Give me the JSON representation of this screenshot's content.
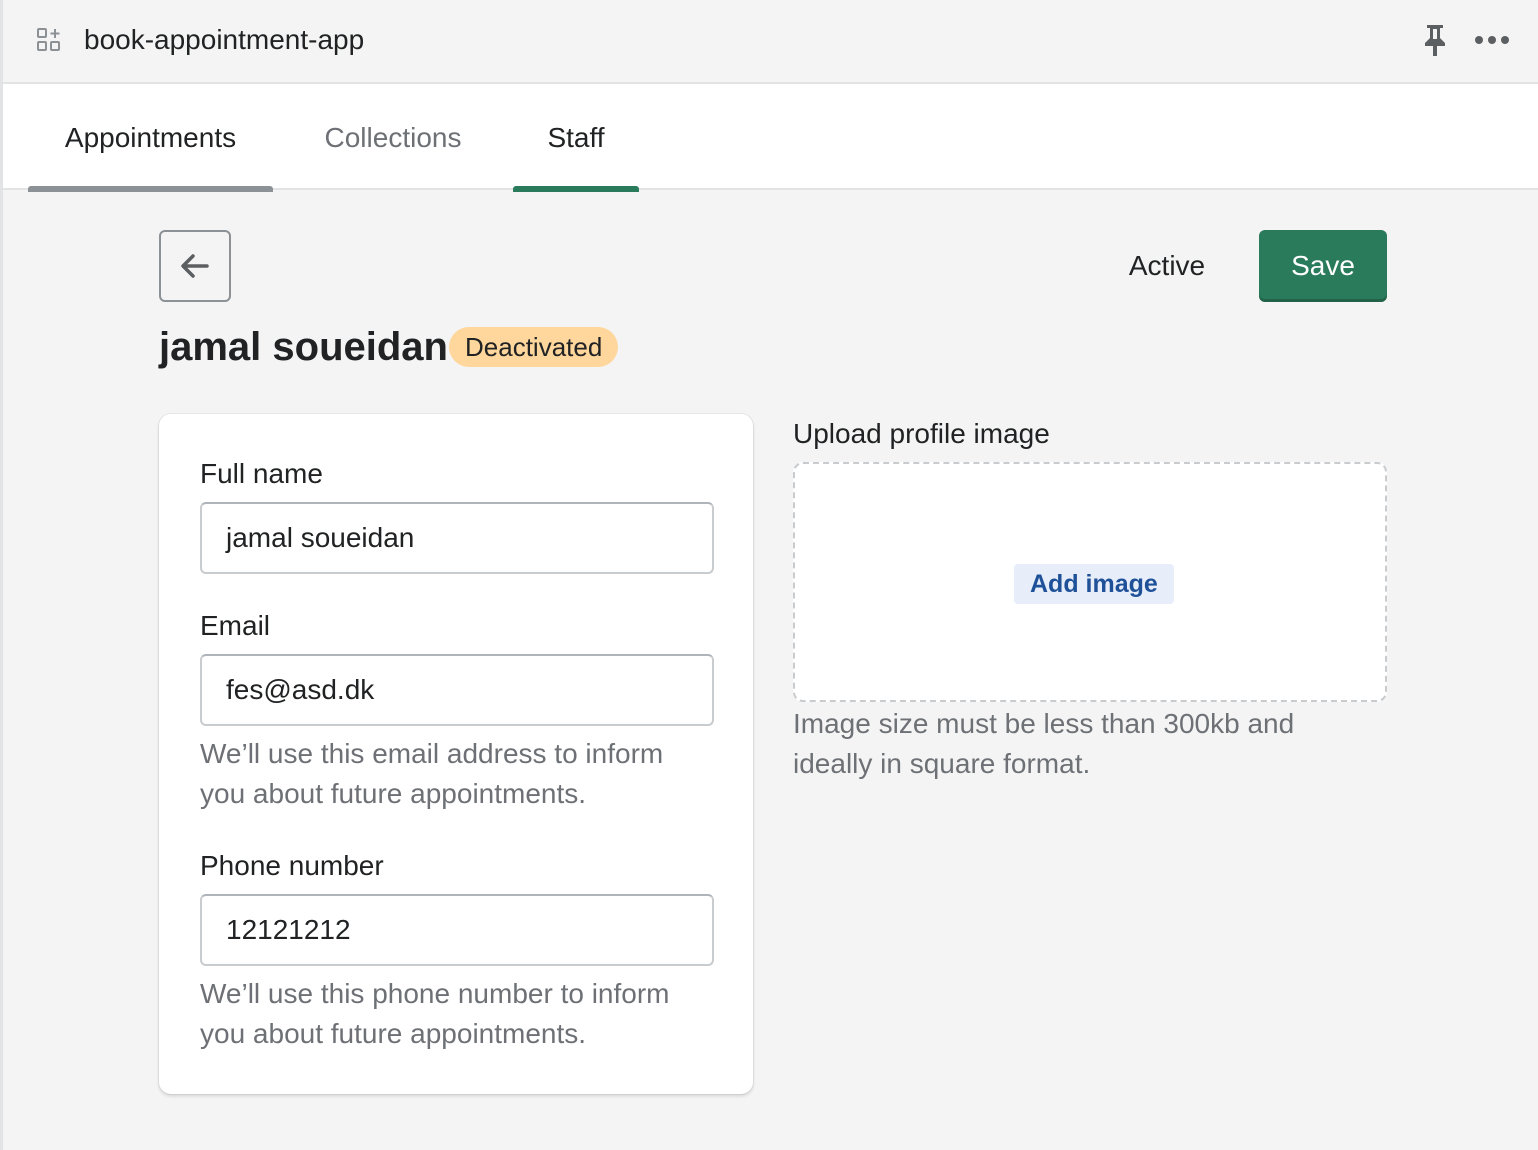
{
  "app": {
    "title": "book-appointment-app"
  },
  "tabs": [
    {
      "label": "Appointments"
    },
    {
      "label": "Collections"
    },
    {
      "label": "Staff"
    }
  ],
  "selected_tab": "Staff",
  "toolbar": {
    "active_label": "Active",
    "save_label": "Save"
  },
  "staff": {
    "name": "jamal soueidan",
    "status": "Deactivated",
    "status_color": "#ffd79d"
  },
  "form": {
    "full_name": {
      "label": "Full name",
      "value": "jamal soueidan"
    },
    "email": {
      "label": "Email",
      "value": "fes@asd.dk",
      "help": "We’ll use this email address to inform you about future appointments."
    },
    "phone": {
      "label": "Phone number",
      "value": "12121212",
      "help": "We’ll use this phone number to inform you about future appointments."
    }
  },
  "upload": {
    "label": "Upload profile image",
    "button_label": "Add image",
    "help": "Image size must be less than 300kb and ideally in square format."
  },
  "colors": {
    "primary": "#2a7b5b",
    "badge_warning": "#ffd79d",
    "link": "#1f5199"
  },
  "icons": [
    "apps-icon",
    "pin-icon",
    "more-icon",
    "arrow-left-icon"
  ]
}
